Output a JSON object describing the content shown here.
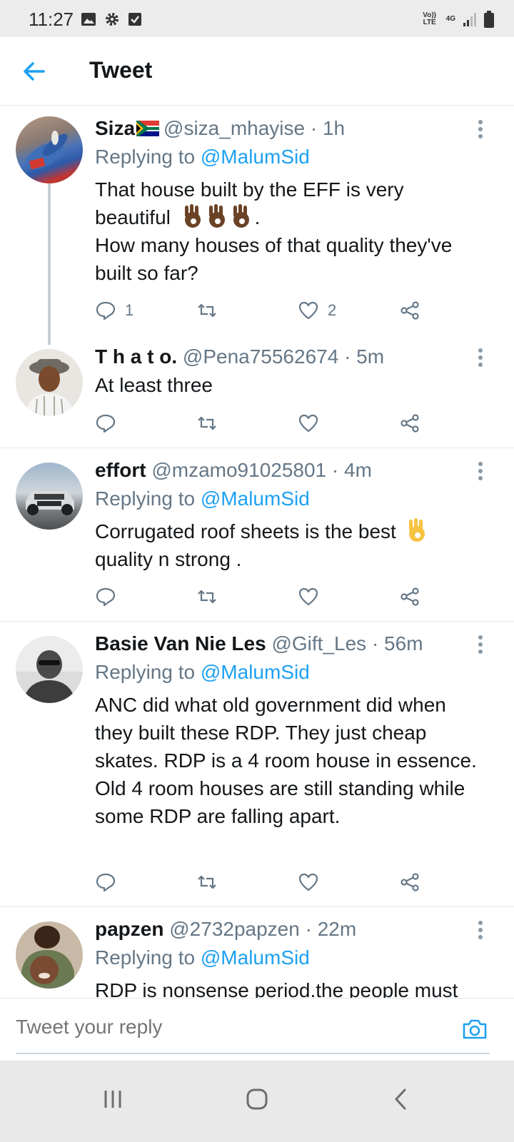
{
  "status_bar": {
    "time": "11:27",
    "network_volte": "Vo)) LTE",
    "network_type": "4G",
    "icons": [
      "gallery-icon",
      "settings-gear-icon",
      "checkbox-icon",
      "signal-icon",
      "battery-icon"
    ]
  },
  "header": {
    "title": "Tweet",
    "back_icon": "arrow-left-icon"
  },
  "tweets": [
    {
      "name": "Siza",
      "flag": "south-africa-flag",
      "handle": "@siza_mhayise",
      "time": "· 1h",
      "replying_prefix": "Replying to ",
      "replying_to": "@MalumSid",
      "text_line1": "That house built by the EFF is very",
      "text_line2": "beautiful",
      "text_line2_suffix": ".",
      "text_line3": "How many houses of that quality they've built so far?",
      "reply_count": "1",
      "like_count": "2"
    },
    {
      "name": "T h a t o.",
      "handle": "@Pena75562674",
      "time": "· 5m",
      "text": "At least three"
    },
    {
      "name": "effort",
      "handle": "@mzamo91025801",
      "time": "· 4m",
      "replying_prefix": "Replying to ",
      "replying_to": "@MalumSid",
      "text_line1": "Corrugated roof sheets is the best",
      "text_line2": "quality n strong ."
    },
    {
      "name": "Basie Van Nie Les",
      "handle": "@Gift_Les",
      "time": "· 56m",
      "replying_prefix": "Replying to ",
      "replying_to": "@MalumSid",
      "text": "ANC did what old government did when they built these RDP. They just cheap skates. RDP is a 4 room house in essence. Old 4 room houses are still standing while some RDP are falling apart."
    },
    {
      "name": "papzen",
      "handle": "@2732papzen",
      "time": "· 22m",
      "replying_prefix": "Replying to ",
      "replying_to": "@MalumSid",
      "text": "RDP is nonsense period.the people must"
    }
  ],
  "composer": {
    "placeholder": "Tweet your reply"
  },
  "colors": {
    "accent": "#1da1f2",
    "secondary_text": "#657786",
    "divider": "#e1e8ed"
  }
}
